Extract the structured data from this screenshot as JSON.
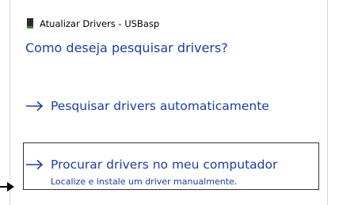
{
  "window": {
    "title": "Atualizar Drivers - USBasp",
    "icon": "usb-device-icon"
  },
  "question": "Como deseja pesquisar drivers?",
  "options": [
    {
      "label": "Pesquisar drivers automaticamente",
      "icon": "arrow-right-icon"
    },
    {
      "label": "Procurar drivers no meu computador",
      "description": "Localize e instale um driver manualmente.",
      "icon": "arrow-right-icon",
      "focused": true
    }
  ],
  "colors": {
    "link": "#1e3e9f",
    "focus_border": "#333333",
    "background": "#ffffff"
  },
  "pointer_icon": "arrow-pointer-icon"
}
